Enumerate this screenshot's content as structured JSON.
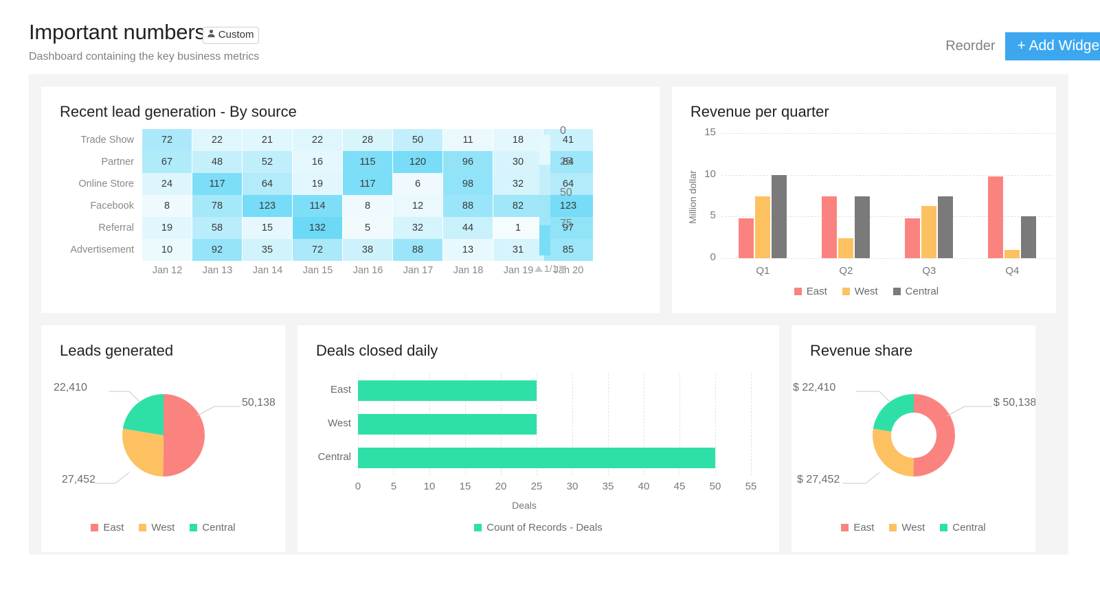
{
  "header": {
    "title": "Important numbers",
    "badge": {
      "label": "Custom",
      "icon": "person-icon"
    },
    "subtitle": "Dashboard containing the key business metrics",
    "reorder_label": "Reorder",
    "add_widget_label": "+ Add Widget",
    "accent_color": "#3CA7EF"
  },
  "palette": {
    "east": "#FA8380",
    "west": "#FDC162",
    "central_bar": "#7A7A7A",
    "central_pie": "#2EE0A8",
    "green": "#2EE0A8",
    "heat_low": "#F6FCFE",
    "heat_high": "#6FDCF5"
  },
  "widgets": {
    "heatmap": {
      "title": "Recent lead generation - By source",
      "pager": "1/1",
      "legend_ticks": [
        "0",
        "25",
        "50",
        "75"
      ],
      "chart_data": {
        "type": "heatmap",
        "title": "Recent lead generation - By source",
        "xlabel": "",
        "ylabel": "",
        "categories": [
          "Jan 12",
          "Jan 13",
          "Jan 14",
          "Jan 15",
          "Jan 16",
          "Jan 17",
          "Jan 18",
          "Jan 19",
          "Jan 20"
        ],
        "rows": [
          "Trade Show",
          "Partner",
          "Online Store",
          "Facebook",
          "Referral",
          "Advertisement"
        ],
        "colorbar": {
          "ticks": [
            0,
            25,
            50,
            75
          ],
          "min": 0,
          "max": 100
        },
        "values": [
          [
            72,
            22,
            21,
            22,
            28,
            50,
            11,
            18,
            41
          ],
          [
            67,
            48,
            52,
            16,
            115,
            120,
            96,
            30,
            84
          ],
          [
            24,
            117,
            64,
            19,
            117,
            6,
            98,
            32,
            64
          ],
          [
            8,
            78,
            123,
            114,
            8,
            12,
            88,
            82,
            123
          ],
          [
            19,
            58,
            15,
            132,
            5,
            32,
            44,
            1,
            97
          ],
          [
            10,
            92,
            35,
            72,
            38,
            88,
            13,
            31,
            85
          ]
        ]
      }
    },
    "colchart": {
      "title": "Revenue per quarter",
      "chart_data": {
        "type": "bar",
        "title": "Revenue per quarter",
        "xlabel": "",
        "ylabel": "Million dollar",
        "categories": [
          "Q1",
          "Q2",
          "Q3",
          "Q4"
        ],
        "yticks": [
          0,
          5,
          10,
          15
        ],
        "ylim": [
          0,
          15
        ],
        "grid": true,
        "legend_position": "bottom",
        "series": [
          {
            "name": "East",
            "color": "#FA8380",
            "values": [
              4.8,
              7.4,
              4.8,
              9.8
            ]
          },
          {
            "name": "West",
            "color": "#FDC162",
            "values": [
              7.4,
              2.4,
              6.3,
              1.0
            ]
          },
          {
            "name": "Central",
            "color": "#7A7A7A",
            "values": [
              10.0,
              7.4,
              7.4,
              5.0
            ]
          }
        ]
      }
    },
    "pie": {
      "title": "Leads generated",
      "chart_data": {
        "type": "pie",
        "title": "Leads generated",
        "legend_position": "bottom",
        "labels": [
          "East",
          "West",
          "Central"
        ],
        "values": [
          50138,
          27452,
          22410
        ],
        "display_labels": [
          "50,138",
          "27,452",
          "22,410"
        ],
        "colors": [
          "#FA8380",
          "#FDC162",
          "#2EE0A8"
        ]
      }
    },
    "hbar": {
      "title": "Deals closed daily",
      "chart_data": {
        "type": "bar",
        "orientation": "horizontal",
        "title": "Deals closed daily",
        "xlabel": "Deals",
        "ylabel": "",
        "categories": [
          "East",
          "West",
          "Central"
        ],
        "values": [
          25,
          25,
          50
        ],
        "xticks": [
          0,
          5,
          10,
          15,
          20,
          25,
          30,
          35,
          40,
          45,
          50,
          55
        ],
        "xlim": [
          0,
          55
        ],
        "grid": true,
        "legend_position": "bottom",
        "series": [
          {
            "name": "Count of Records - Deals",
            "color": "#2EE0A8",
            "values": [
              25,
              25,
              50
            ]
          }
        ]
      }
    },
    "donut": {
      "title": "Revenue share",
      "chart_data": {
        "type": "pie",
        "variant": "donut",
        "title": "Revenue share",
        "legend_position": "bottom",
        "labels": [
          "East",
          "West",
          "Central"
        ],
        "values": [
          50138,
          27452,
          22410
        ],
        "display_labels": [
          "$ 50,138",
          "$ 27,452",
          "$ 22,410"
        ],
        "colors": [
          "#FA8380",
          "#FDC162",
          "#2EE0A8"
        ]
      }
    }
  }
}
